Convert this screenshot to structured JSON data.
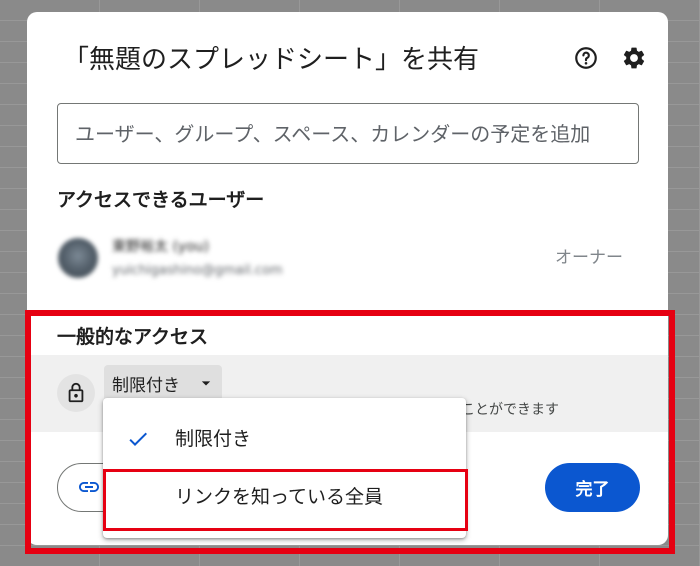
{
  "dialog": {
    "title": "「無題のスプレッドシート」を共有"
  },
  "share_input": {
    "placeholder": "ユーザー、グループ、スペース、カレンダーの予定を追加",
    "value": ""
  },
  "people_section": {
    "heading": "アクセスできるユーザー",
    "users": [
      {
        "name": "東野裕太 (you)",
        "email": "yuichigashino@gmail.com",
        "role": "オーナー",
        "blurred": true
      }
    ]
  },
  "general_access": {
    "heading": "一般的なアクセス",
    "selected": "制限付き",
    "description_visible": "ことができます"
  },
  "access_menu": {
    "options": [
      {
        "label": "制限付き",
        "checked": true,
        "highlighted": false
      },
      {
        "label": "リンクを知っている全員",
        "checked": false,
        "highlighted": true
      }
    ]
  },
  "footer": {
    "done_label": "完了"
  },
  "icons": {
    "help": "help-circle-icon",
    "settings": "gear-icon",
    "access": "lock-icon",
    "dropdown": "caret-down-icon",
    "copy_link": "link-icon",
    "selected_option": "check-icon"
  },
  "colors": {
    "accent": "#0b57d0",
    "highlight_red": "#e60012",
    "access_row_background": "#f0f0f0"
  }
}
